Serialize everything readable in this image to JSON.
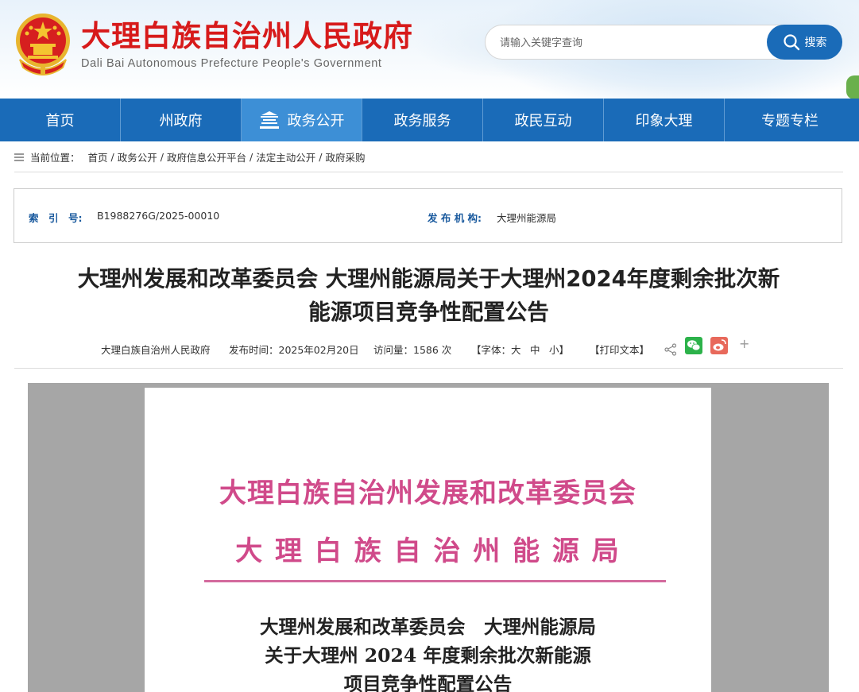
{
  "site": {
    "title": "大理白族自治州人民政府",
    "subtitle": "Dali Bai Autonomous Prefecture People's Government"
  },
  "search": {
    "placeholder": "请输入关键字查询",
    "button_label": "搜索"
  },
  "nav": {
    "items": [
      {
        "label": "首页"
      },
      {
        "label": "州政府"
      },
      {
        "label": "政务公开",
        "icon": "building-icon",
        "active": true
      },
      {
        "label": "政务服务"
      },
      {
        "label": "政民互动"
      },
      {
        "label": "印象大理"
      },
      {
        "label": "专题专栏"
      }
    ]
  },
  "breadcrumb": {
    "prefix": "当前位置：",
    "items": [
      "首页",
      "政务公开",
      "政府信息公开平台",
      "法定主动公开",
      "政府采购"
    ],
    "separator": "/"
  },
  "meta": {
    "index_label": "索　引　号:",
    "index_value": "B1988276G/2025-00010",
    "publisher_label": "发 布 机 构:",
    "publisher_value": "大理州能源局"
  },
  "article": {
    "title_line1": "大理州发展和改革委员会 大理州能源局关于大理州2024年度剩余批次新",
    "title_line2": "能源项目竞争性配置公告",
    "source": "大理白族自治州人民政府",
    "publish_time": "发布时间：2025年02月20日",
    "visits": "访问量：1586 次",
    "font_label": "【字体：",
    "font_large": "大",
    "font_medium": "中",
    "font_small": "小】",
    "print_label": "【打印文本】"
  },
  "share": {
    "icons": [
      "share-icon",
      "wechat-icon",
      "weibo-icon",
      "plus-icon"
    ],
    "plus": "+"
  },
  "document": {
    "header_line1": "大理白族自治州发展和改革委员会",
    "header_line2": "大 理 白 族 自 治 州 能 源 局",
    "title_line1": "大理州发展和改革委员会　大理州能源局",
    "title_line2": "关于大理州 2024 年度剩余批次新能源",
    "title_line3": "项目竞争性配置公告"
  },
  "colors": {
    "brand_red": "#d71a1a",
    "nav_blue": "#1a6bb8",
    "nav_active": "#3d8fd6",
    "doc_red": "#d04a8a"
  }
}
